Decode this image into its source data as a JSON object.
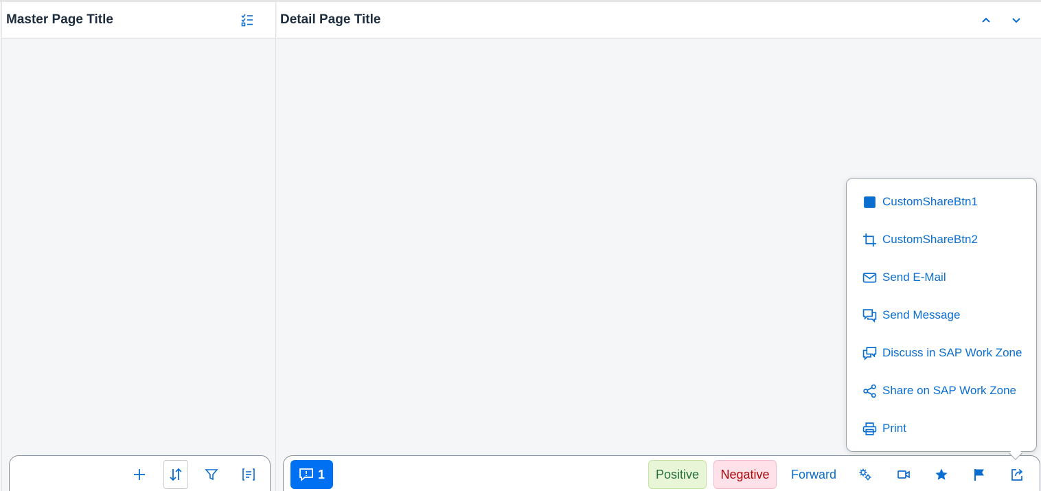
{
  "master": {
    "title": "Master Page Title",
    "header_icon": "multi-select-icon",
    "footer_icons": [
      "add-icon",
      "sort-icon",
      "filter-icon",
      "group-icon"
    ]
  },
  "detail": {
    "title": "Detail Page Title",
    "nav_icons": [
      "chevron-up-icon",
      "chevron-down-icon"
    ],
    "footer": {
      "message_count": "1",
      "positive_label": "Positive",
      "negative_label": "Negative",
      "forward_label": "Forward",
      "icons": [
        "settings-icon",
        "video-icon",
        "favorite-icon",
        "flag-icon",
        "share-icon"
      ]
    }
  },
  "share_menu": {
    "items": [
      {
        "label": "CustomShareBtn1",
        "icon": "square-icon"
      },
      {
        "label": "CustomShareBtn2",
        "icon": "crop-icon"
      },
      {
        "label": "Send E-Mail",
        "icon": "email-icon"
      },
      {
        "label": "Send Message",
        "icon": "message-icon"
      },
      {
        "label": "Discuss in SAP Work Zone",
        "icon": "discussion-icon"
      },
      {
        "label": "Share on SAP Work Zone",
        "icon": "share-network-icon"
      },
      {
        "label": "Print",
        "icon": "print-icon"
      }
    ]
  },
  "colors": {
    "accent": "#0a6ed1",
    "emphasized": "#0070f2",
    "positive_bg": "#e8f5d6",
    "negative_bg": "#ffe1ea"
  }
}
